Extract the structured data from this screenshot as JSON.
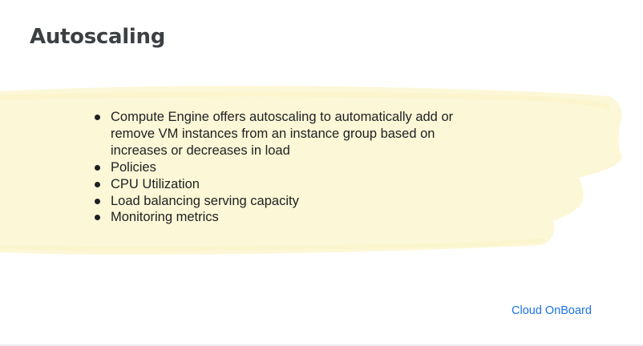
{
  "slide": {
    "title": "Autoscaling",
    "bullets": [
      "Compute Engine offers autoscaling to automatically add or remove VM instances from an instance group based on increases or decreases in load",
      "Policies",
      "CPU Utilization",
      "Load balancing serving capacity",
      "Monitoring metrics"
    ],
    "brand": "Cloud OnBoard"
  },
  "colors": {
    "title_text": "#3c4043",
    "body_text": "#202124",
    "highlight": "#fcf7d6",
    "brand": "#1a73e8"
  }
}
